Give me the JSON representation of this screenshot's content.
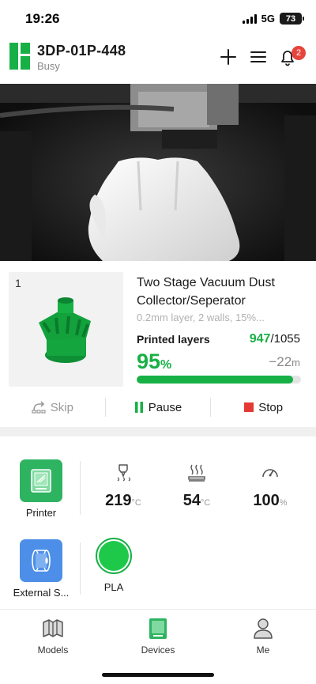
{
  "status_bar": {
    "time": "19:26",
    "network": "5G",
    "battery": "73"
  },
  "header": {
    "device_name": "3DP-01P-448",
    "device_status": "Busy",
    "notification_count": "2"
  },
  "job": {
    "plate_number": "1",
    "title": "Two Stage Vacuum Dust Collector/Seperator",
    "meta": "0.2mm layer, 2 walls, 15%...",
    "layers_label": "Printed layers",
    "layers_current": "947",
    "layers_total": "/1055",
    "progress_percent": "95",
    "progress_unit": "%",
    "progress_fraction": 0.95,
    "remaining_value": "−22",
    "remaining_unit": "m"
  },
  "controls": {
    "skip": "Skip",
    "pause": "Pause",
    "stop": "Stop"
  },
  "status": {
    "printer_label": "Printer",
    "nozzle_temp": "219",
    "nozzle_unit": "°C",
    "bed_temp": "54",
    "bed_unit": "°C",
    "speed": "100",
    "speed_unit": "%",
    "external_spool_label": "External S...",
    "filament_label": "PLA"
  },
  "colors": {
    "accent": "#17b045",
    "filament": "#1ec94a",
    "spool_tile": "#4d8fe8",
    "badge": "#e5443b",
    "stop": "#e53935"
  },
  "icons": {
    "logo": "bambu-logo-icon",
    "add": "plus-icon",
    "menu": "menu-icon",
    "notifications": "bell-icon",
    "skip": "skip-icon",
    "pause": "pause-icon",
    "stop": "stop-icon",
    "printer": "printer-icon",
    "nozzle": "nozzle-icon",
    "bed": "heatbed-icon",
    "speed": "speedometer-icon",
    "spool": "spool-icon",
    "models": "models-icon",
    "devices": "devices-icon",
    "me": "profile-icon"
  },
  "tabs": {
    "models": "Models",
    "devices": "Devices",
    "me": "Me"
  }
}
